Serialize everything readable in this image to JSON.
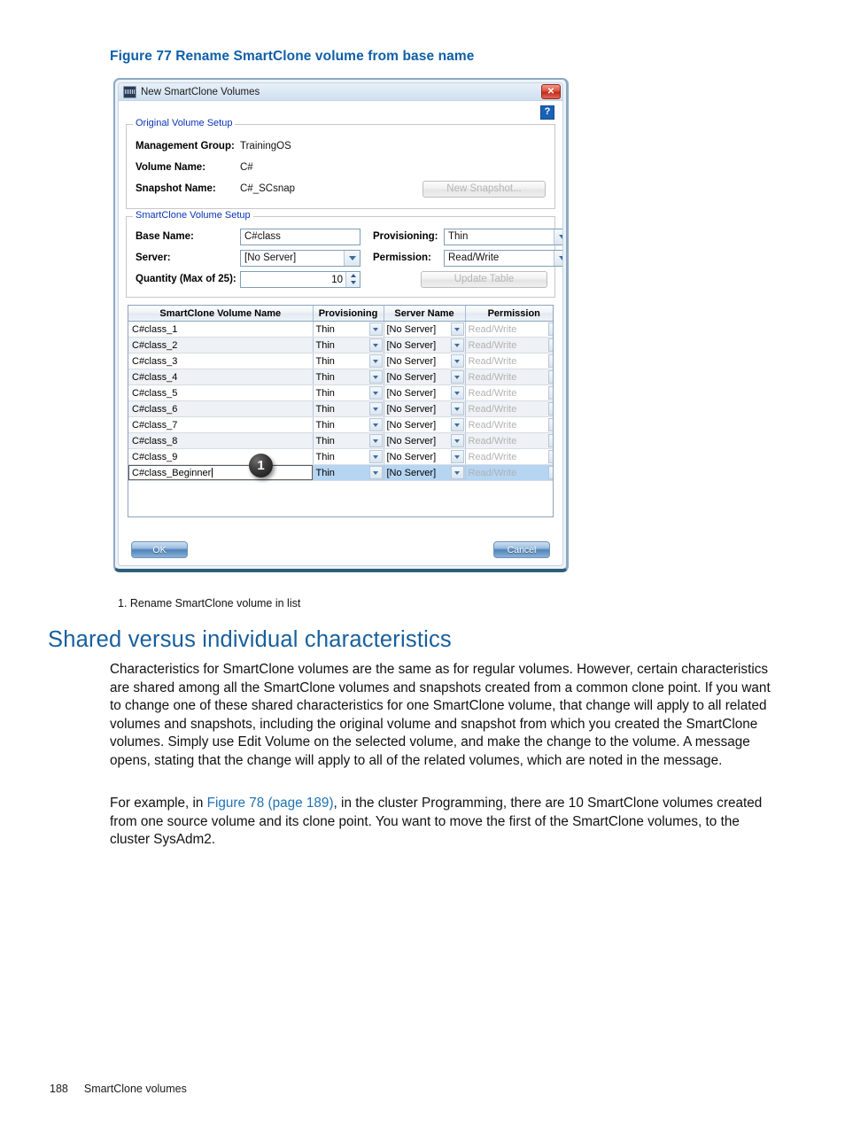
{
  "figure": {
    "caption": "Figure 77 Rename SmartClone volume from base name",
    "legend_note": "1. Rename SmartClone volume in list",
    "callout_number": "1"
  },
  "dialog": {
    "title": "New SmartClone Volumes",
    "title_icon": "application-icon",
    "close_label": "✕",
    "help_label": "?",
    "original_volume_setup": {
      "legend": "Original Volume Setup",
      "fields": [
        {
          "label": "Management Group:",
          "value": "TrainingOS"
        },
        {
          "label": "Volume Name:",
          "value": "C#"
        },
        {
          "label": "Snapshot Name:",
          "value": "C#_SCsnap"
        }
      ],
      "new_snapshot_button": "New Snapshot..."
    },
    "smartclone_volume_setup": {
      "legend": "SmartClone Volume Setup",
      "base_name_label": "Base Name:",
      "base_name_value": "C#class",
      "provisioning_label": "Provisioning:",
      "provisioning_value": "Thin",
      "server_label": "Server:",
      "server_value": "[No Server]",
      "permission_label": "Permission:",
      "permission_value": "Read/Write",
      "quantity_label": "Quantity (Max of 25):",
      "quantity_value": "10",
      "update_table_button": "Update Table"
    },
    "table": {
      "columns": [
        "SmartClone Volume Name",
        "Provisioning",
        "Server Name",
        "Permission"
      ],
      "rows": [
        {
          "name": "C#class_1",
          "provisioning": "Thin",
          "server": "[No Server]",
          "permission": "Read/Write",
          "selected": false,
          "editing": false
        },
        {
          "name": "C#class_2",
          "provisioning": "Thin",
          "server": "[No Server]",
          "permission": "Read/Write",
          "selected": false,
          "editing": false
        },
        {
          "name": "C#class_3",
          "provisioning": "Thin",
          "server": "[No Server]",
          "permission": "Read/Write",
          "selected": false,
          "editing": false
        },
        {
          "name": "C#class_4",
          "provisioning": "Thin",
          "server": "[No Server]",
          "permission": "Read/Write",
          "selected": false,
          "editing": false
        },
        {
          "name": "C#class_5",
          "provisioning": "Thin",
          "server": "[No Server]",
          "permission": "Read/Write",
          "selected": false,
          "editing": false
        },
        {
          "name": "C#class_6",
          "provisioning": "Thin",
          "server": "[No Server]",
          "permission": "Read/Write",
          "selected": false,
          "editing": false
        },
        {
          "name": "C#class_7",
          "provisioning": "Thin",
          "server": "[No Server]",
          "permission": "Read/Write",
          "selected": false,
          "editing": false
        },
        {
          "name": "C#class_8",
          "provisioning": "Thin",
          "server": "[No Server]",
          "permission": "Read/Write",
          "selected": false,
          "editing": false
        },
        {
          "name": "C#class_9",
          "provisioning": "Thin",
          "server": "[No Server]",
          "permission": "Read/Write",
          "selected": false,
          "editing": false
        },
        {
          "name": "C#class_Beginner",
          "provisioning": "Thin",
          "server": "[No Server]",
          "permission": "Read/Write",
          "selected": true,
          "editing": true
        }
      ]
    },
    "ok_button": "OK",
    "cancel_button": "Cancel"
  },
  "section": {
    "heading": "Shared versus individual characteristics",
    "paragraph_1": "Characteristics for SmartClone volumes are the same as for regular volumes. However, certain characteristics are shared among all the SmartClone volumes and snapshots created from a common clone point. If you want to change one of these shared characteristics for one SmartClone volume, that change will apply to all related volumes and snapshots, including the original volume and snapshot from which you created the SmartClone volumes. Simply use Edit Volume on the selected volume, and make the change to the volume. A message opens, stating that the change will apply to all of the related volumes, which are noted in the message.",
    "paragraph_2_before": "For example, in ",
    "paragraph_2_link": "Figure 78 (page 189)",
    "paragraph_2_after": ", in the cluster Programming, there are 10 SmartClone volumes created from one source volume and its clone point. You want to move the first of the SmartClone volumes, to the cluster SysAdm2."
  },
  "footer": {
    "page_number": "188",
    "section_title": "SmartClone volumes"
  },
  "colors": {
    "heading_blue": "#185f9c",
    "caption_blue": "#0f5fa8",
    "link_blue": "#1f72b5",
    "legend_blue": "#0a34b5",
    "selected_row": "#b5d5f2",
    "close_red": "#c02c1a"
  }
}
